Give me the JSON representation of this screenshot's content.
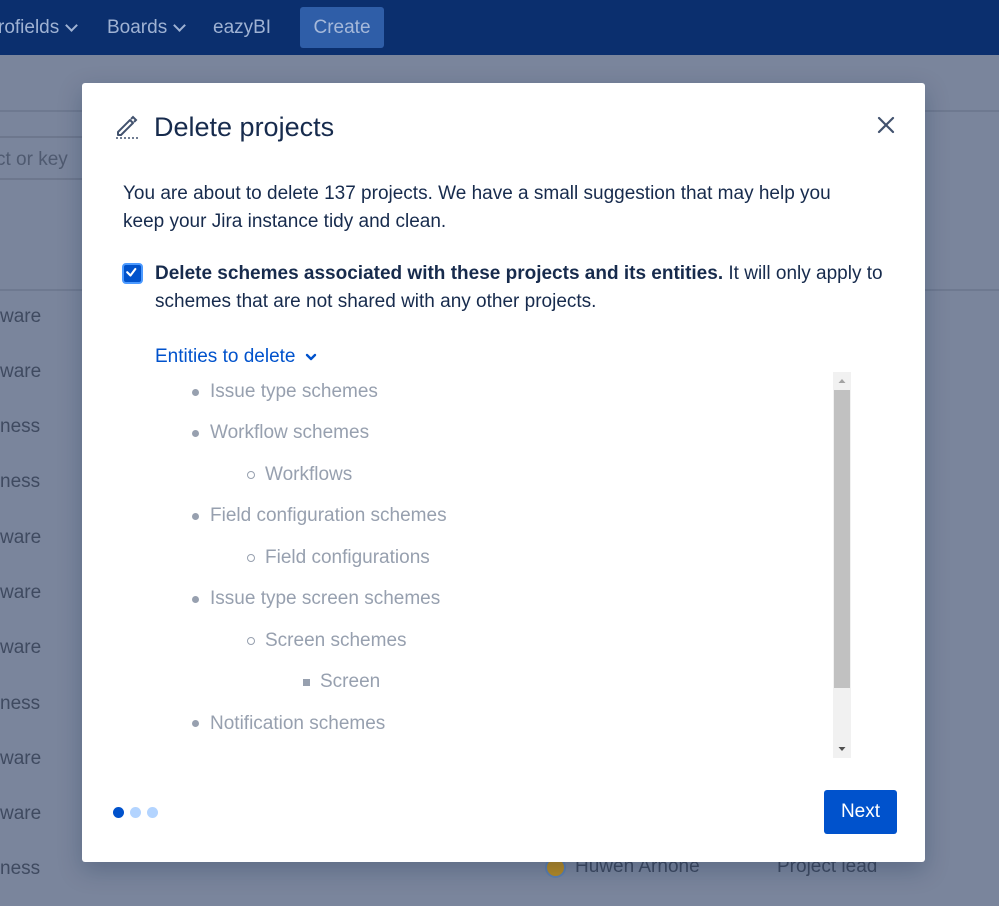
{
  "colors": {
    "primary": "#0052cc",
    "navbar": "#0b2f6e",
    "overlay": "#7a859c",
    "dot_active": "#0052cc",
    "dot_inactive": "#b3d4ff"
  },
  "topbar": {
    "items": [
      {
        "label": "rofields",
        "has_chevron": true
      },
      {
        "label": "Boards",
        "has_chevron": true
      },
      {
        "label": "eazyBI",
        "has_chevron": false
      }
    ],
    "create_label": "Create"
  },
  "background": {
    "search_placeholder": "ct or key",
    "rows": [
      "ware",
      "ware",
      "ness",
      "ness",
      "ware",
      "ware",
      "ware",
      "ness",
      "ware",
      "ware",
      "ness"
    ],
    "lead_name": "Huwen Arnone",
    "role": "Project lead"
  },
  "modal": {
    "title": "Delete projects",
    "title_icon": "pencil-icon",
    "close_icon": "close-icon",
    "intro": "You are about to delete 137 projects. We have a small suggestion that may help you keep your Jira instance tidy and clean.",
    "checkbox": {
      "checked": true,
      "label_bold": "Delete schemes associated with these projects and its entities.",
      "label_rest": " It will only apply to schemes that are not shared with any other projects."
    },
    "entities_toggle": "Entities to delete",
    "entities": [
      {
        "label": "Issue type schemes",
        "level": 1
      },
      {
        "label": "Workflow schemes",
        "level": 1
      },
      {
        "label": "Workflows",
        "level": 2
      },
      {
        "label": "Field configuration schemes",
        "level": 1
      },
      {
        "label": "Field configurations",
        "level": 2
      },
      {
        "label": "Issue type screen schemes",
        "level": 1
      },
      {
        "label": "Screen schemes",
        "level": 2
      },
      {
        "label": "Screen",
        "level": 3
      },
      {
        "label": "Notification schemes",
        "level": 1
      }
    ],
    "steps": {
      "total": 3,
      "current": 1
    },
    "next_label": "Next"
  }
}
